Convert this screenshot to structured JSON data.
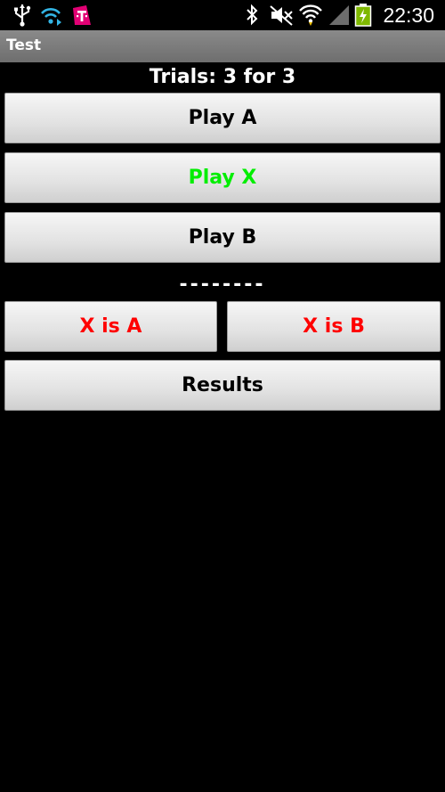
{
  "status_bar": {
    "time": "22:30",
    "left_icons": [
      "usb-icon",
      "wifi-sync-icon",
      "tmobile-icon"
    ],
    "right_icons": [
      "bluetooth-icon",
      "mute-icon",
      "wifi-icon",
      "signal-icon",
      "battery-charging-icon"
    ]
  },
  "titlebar": {
    "title": "Test"
  },
  "main": {
    "trials_label": "Trials: 3 for 3",
    "play_a_label": "Play A",
    "play_x_label": "Play X",
    "play_b_label": "Play B",
    "separator": "--------",
    "x_is_a_label": "X is A",
    "x_is_b_label": "X is B",
    "results_label": "Results"
  },
  "colors": {
    "play_x_text": "#00ee00",
    "choice_text": "#ff0000",
    "titlebar": "#7a7a7a",
    "background": "#000000"
  }
}
